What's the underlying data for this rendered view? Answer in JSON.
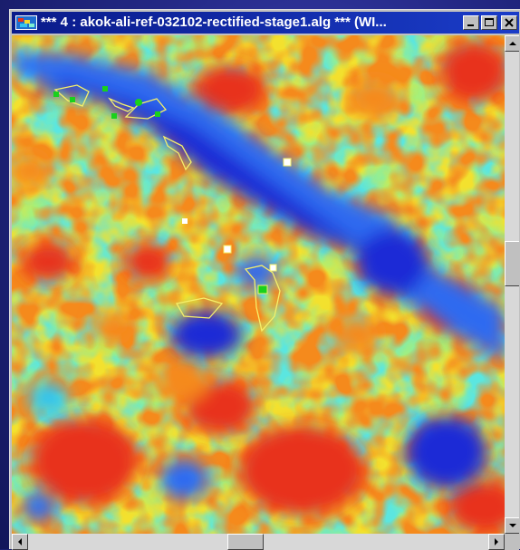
{
  "window": {
    "title": "*** 4 : akok-ali-ref-032102-rectified-stage1.alg *** (WI...",
    "icon": "raster-image-icon"
  },
  "titlebar_buttons": {
    "minimize_icon": "minimize-icon",
    "maximize_icon": "maximize-icon",
    "close_icon": "close-icon"
  },
  "map": {
    "colormap": [
      "#1a2bd6",
      "#2f6bf0",
      "#32c3f0",
      "#7cf0d2",
      "#d6f04a",
      "#f7d82b",
      "#f58a1e",
      "#e8321a"
    ],
    "vector_color": "#f5f06a",
    "marker_green": "#19d11c",
    "marker_white": "#ffffff"
  },
  "scrollbars": {
    "vertical_position": 0.45,
    "horizontal_position": 0.47
  }
}
